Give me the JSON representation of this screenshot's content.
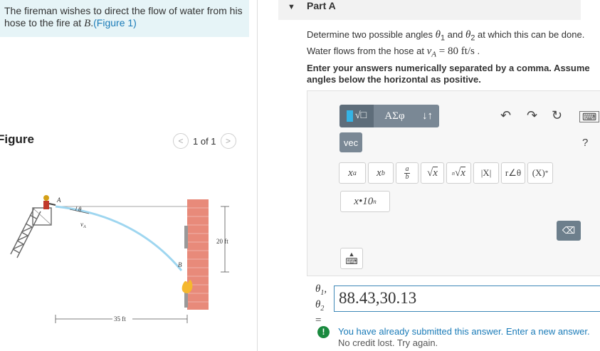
{
  "problem": {
    "text_before": "The fireman wishes to direct the flow of water from his hose to the fire at ",
    "point": "B",
    "text_after": ".",
    "figure_link": "(Figure 1)"
  },
  "figure_panel": {
    "heading": "Figure",
    "pager_text": "1 of 1",
    "labels": {
      "point_a": "A",
      "point_b": "B",
      "angle": "θ",
      "velocity": "v",
      "velocity_sub": "A",
      "height": "20 ft",
      "distance": "35 ft"
    }
  },
  "part": {
    "title": "Part A",
    "question_pre": "Determine two possible angles ",
    "theta1": "θ",
    "theta1_sub": "1",
    "question_and": " and ",
    "theta2": "θ",
    "theta2_sub": "2",
    "question_mid": " at which this can be done. Water flows from the hose at ",
    "va": "v",
    "va_sub": "A",
    "va_value": " = 80 ",
    "va_unit": "ft/s",
    "question_end": " .",
    "instruction": "Enter your answers numerically separated by a comma. Assume angles below the horizontal as positive."
  },
  "toolbar": {
    "greek_label": "ΑΣφ",
    "arrows_label": "↓↑",
    "vec_label": "vec",
    "help_label": "?",
    "abs_label": "|X|",
    "angle_label": "r∠θ",
    "vector_label": "(X)",
    "vector_sup": "*",
    "sci_label": "x•10",
    "sci_sup": "n"
  },
  "answer": {
    "label_line1": "θ",
    "label_line1_sub": "1",
    "label_line2": "θ",
    "label_line2_sub": "2",
    "label_eq": "=",
    "value": "88.43,30.13"
  },
  "feedback": {
    "icon": "!",
    "main": "You have already submitted this answer. Enter a new answer.",
    "sub": "No credit lost. Try again."
  },
  "colors": {
    "problem_bg": "#e6f4f7",
    "link": "#1a7bb8",
    "toolbar_dark": "#5e6d7a",
    "alert_green": "#1a8a3f",
    "input_border": "#3e88b8"
  }
}
